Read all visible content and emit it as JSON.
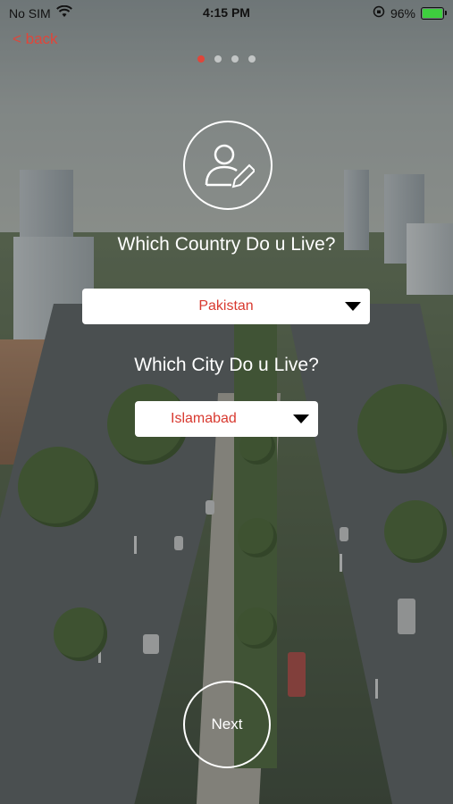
{
  "status_bar": {
    "carrier": "No SIM",
    "time": "4:15 PM",
    "battery": "96%",
    "wifi_icon": "wifi-icon",
    "lock_icon": "orientation-lock-icon"
  },
  "nav": {
    "back_label": "< back"
  },
  "pager": {
    "count": 4,
    "active_index": 0
  },
  "profile": {
    "icon": "user-edit-icon"
  },
  "country": {
    "question": "Which Country Do u Live?",
    "selected": "Pakistan"
  },
  "city": {
    "question": "Which City  Do u Live?",
    "selected": "Islamabad"
  },
  "actions": {
    "next_label": "Next"
  },
  "colors": {
    "accent": "#e0463a",
    "select_text": "#d8392f"
  }
}
